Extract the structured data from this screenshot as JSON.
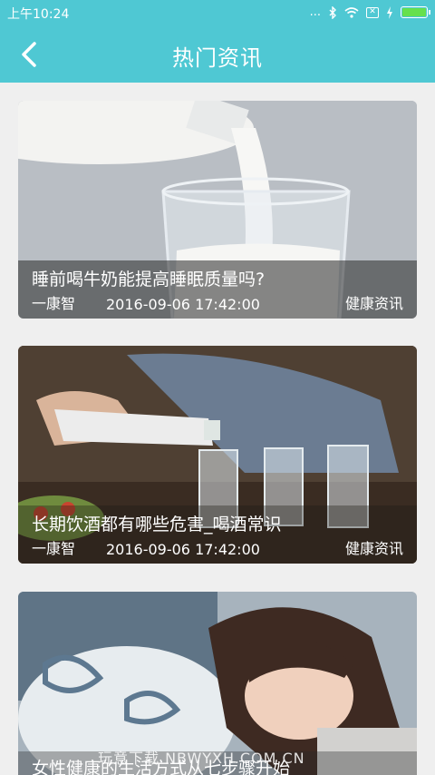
{
  "status_bar": {
    "time": "上午10:24",
    "signal_dots": "...",
    "sim_icon": "✕"
  },
  "header": {
    "title": "热门资讯"
  },
  "articles": [
    {
      "title": "睡前喝牛奶能提高睡眠质量吗?",
      "source": "一康智",
      "date": "2016-09-06 17:42:00",
      "category": "健康资讯"
    },
    {
      "title": "长期饮酒都有哪些危害_喝酒常识",
      "source": "一康智",
      "date": "2016-09-06 17:42:00",
      "category": "健康资讯"
    },
    {
      "title": "女性健康的生活方式从七步骤开始",
      "source": "",
      "date": "",
      "category": ""
    }
  ],
  "watermark": "玩意下载  NBWYXH.COM.CN",
  "colors": {
    "accent": "#4fc8d3",
    "battery": "#66e04d",
    "background": "#efefef"
  }
}
